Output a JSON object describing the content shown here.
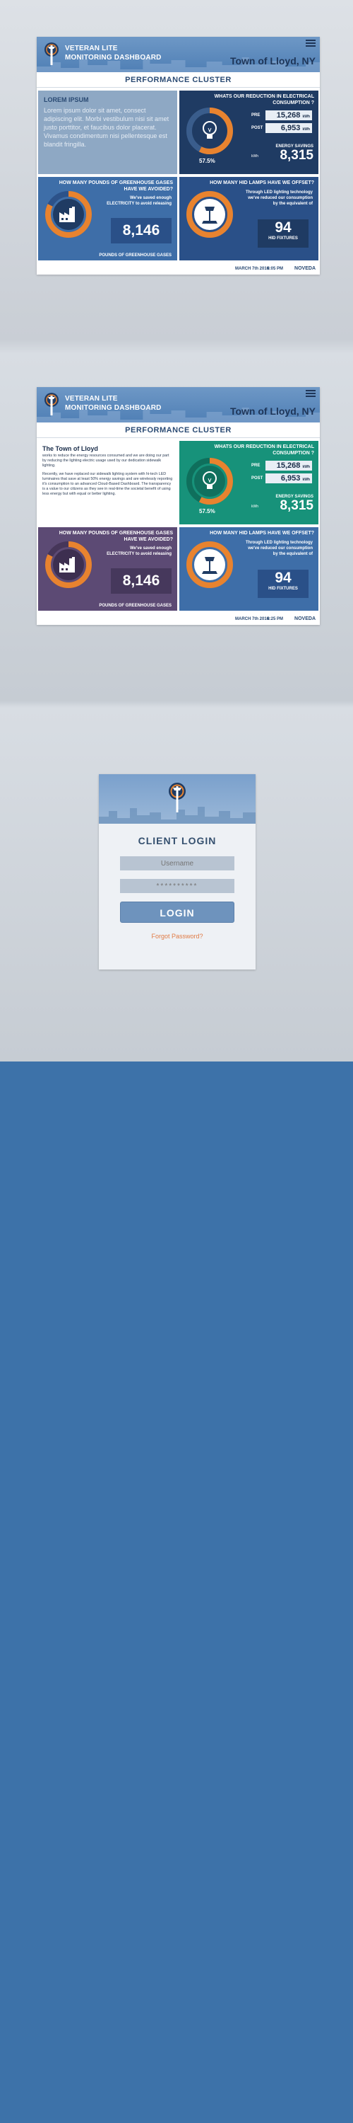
{
  "screen1": {
    "header": {
      "title_line1": "VETERAN LITE",
      "title_line2": "MONITORING DASHBOARD",
      "town": "Town of Lloyd, NY"
    },
    "cluster_title": "PERFORMANCE CLUSTER",
    "lorem": {
      "title": "LOREM IPSUM",
      "text": "Lorem ipsum dolor sit amet, consect adipiscing elit. Morbi vestibulum nisi sit amet justo porttitor, et faucibus dolor placerat. Vivamus condimentum nisi pellentesque est blandit fringilla."
    },
    "consumption": {
      "title": "WHATS OUR REDUCTION IN ELECTRICAL CONSUMPTION ?",
      "pre_label": "PRE",
      "pre_value": "15,268",
      "pre_unit": "kWh",
      "post_label": "POST",
      "post_value": "6,953",
      "post_unit": "kWh",
      "energy_label": "ENERGY SAVINGS",
      "energy_unit": "kWh",
      "energy_value": "8,315",
      "percent": "57.5%"
    },
    "greenhouse": {
      "title": "HOW MANY POUNDS OF GREENHOUSE GASES HAVE WE AVOIDED?",
      "sub": "We've saved enough ELECTRICITY to avoid releasing",
      "value": "8,146",
      "footer": "POUNDS OF GREENHOUSE GASES"
    },
    "lamps": {
      "title": "HOW MANY HID LAMPS HAVE WE OFFSET?",
      "sub": "Through LED lighting technology we've reduced our consumption by the equivalent of",
      "value": "94",
      "label": "HID FIXTURES"
    },
    "footer": {
      "date": "MARCH 7th 2016",
      "time": "8:05 PM",
      "brand": "NOVEDA"
    }
  },
  "screen2": {
    "header": {
      "title_line1": "VETERAN LITE",
      "title_line2": "MONITORING DASHBOARD",
      "town": "Town of Lloyd, NY"
    },
    "cluster_title": "PERFORMANCE CLUSTER",
    "town_info": {
      "title": "The Town of Lloyd",
      "para1": "works to reduce the energy resources consumed and we are doing our part by reducing the lighting electric usage used by our dedication sidewalk lighting.",
      "para2": "Recently, we have replaced our sidewalk lighting system with hi-tech LED luminaires that save at least 50% energy savings and are wirelessly reporting it's consumption to an advanced Cloud-Based Dashboard. The transparency is a value to our citizens as they see in real-time the societal benefit of using less energy but with equal or better lighting."
    },
    "consumption": {
      "title": "WHATS OUR REDUCTION IN ELECTRICAL CONSUMPTION ?",
      "pre_label": "PRE",
      "pre_value": "15,268",
      "pre_unit": "kWh",
      "post_label": "POST",
      "post_value": "6,953",
      "post_unit": "kWh",
      "energy_label": "ENERGY SAVINGS",
      "energy_unit": "kWh",
      "energy_value": "8,315",
      "percent": "57.5%"
    },
    "greenhouse": {
      "title": "HOW MANY POUNDS OF GREENHOUSE GASES HAVE WE AVOIDED?",
      "sub": "We've saved enough ELECTRICITY to avoid releasing",
      "value": "8,146",
      "footer": "POUNDS OF GREENHOUSE GASES"
    },
    "lamps": {
      "title": "HOW MANY HID LAMPS HAVE WE OFFSET?",
      "sub": "Through LED lighting technology we've reduced our consumption by the equivalent of",
      "value": "94",
      "label": "HID FIXTURES"
    },
    "footer": {
      "date": "MARCH 7th 2016",
      "time": "8:25 PM",
      "brand": "NOVEDA"
    }
  },
  "login": {
    "title": "CLIENT LOGIN",
    "username_placeholder": "Username",
    "password_placeholder": "**********",
    "button": "LOGIN",
    "forgot": "Forgot Password?"
  },
  "icons": {
    "logo": "streetlight-logo-icon",
    "menu": "hamburger-menu-icon",
    "bulb": "lightbulb-icon",
    "factory": "factory-icon",
    "lamp": "streetlamp-icon"
  },
  "colors": {
    "header_blue": "#5a89bd",
    "dark_navy": "#1f3b63",
    "panel_blue": "#3e6ea8",
    "slate": "#7f9bbb",
    "teal": "#17927a",
    "plum": "#5c4a74",
    "orange": "#e8832f",
    "page_blue": "#3d72a9"
  }
}
